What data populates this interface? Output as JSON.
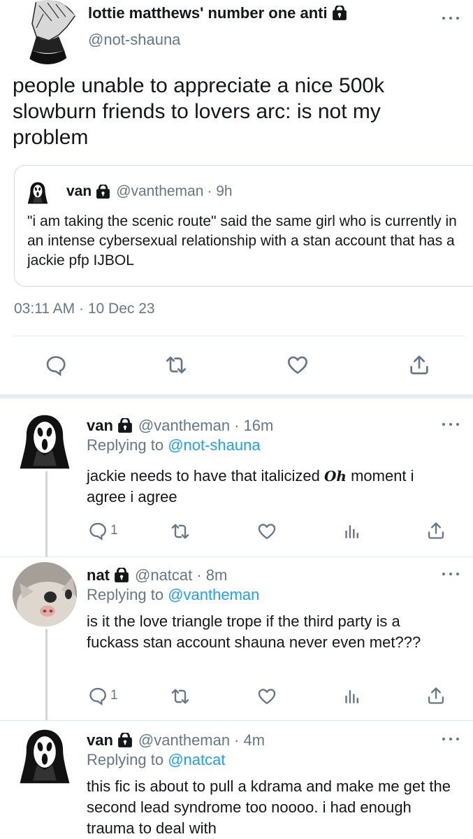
{
  "main_tweet": {
    "display_name": "lottie matthews' number one anti",
    "handle": "@not-shauna",
    "text": "people unable to appreciate a nice 500k slowburn friends to lovers arc: is not my problem",
    "quote": {
      "display_name": "van",
      "handle": "@vantheman",
      "time": "· 9h",
      "text": "\"i am taking the scenic route\" said the same girl who is currently in an intense cybersexual relationship with a stan account that has a jackie pfp IJBOL"
    },
    "timestamp": "03:11 AM · 10 Dec 23"
  },
  "replies": [
    {
      "display_name": "van",
      "handle": "@vantheman",
      "time": "· 16m",
      "replying_prefix": "Replying to ",
      "replying_to": "@not-shauna",
      "text_before": "jackie needs to have that italicized ",
      "oh": "Oh",
      "text_after": " moment i agree i agree",
      "reply_count": "1"
    },
    {
      "display_name": "nat",
      "handle": "@natcat",
      "time": "· 8m",
      "replying_prefix": "Replying to ",
      "replying_to": "@vantheman",
      "text": "is it the love triangle trope if the third party is a fuckass stan account shauna never even met???",
      "reply_count": "1"
    },
    {
      "display_name": "van",
      "handle": "@vantheman",
      "time": "· 4m",
      "replying_prefix": "Replying to ",
      "replying_to": "@natcat",
      "text": "this fic is about to pull a kdrama and make me get the second lead syndrome too noooo. i had enough trauma to deal with"
    }
  ],
  "colors": {
    "link": "#1da1f2",
    "secondary": "#657786",
    "divider": "#e1e8ed"
  },
  "icons": [
    "lock-icon",
    "more-icon",
    "reply-icon",
    "retweet-icon",
    "like-icon",
    "share-icon",
    "views-icon"
  ]
}
